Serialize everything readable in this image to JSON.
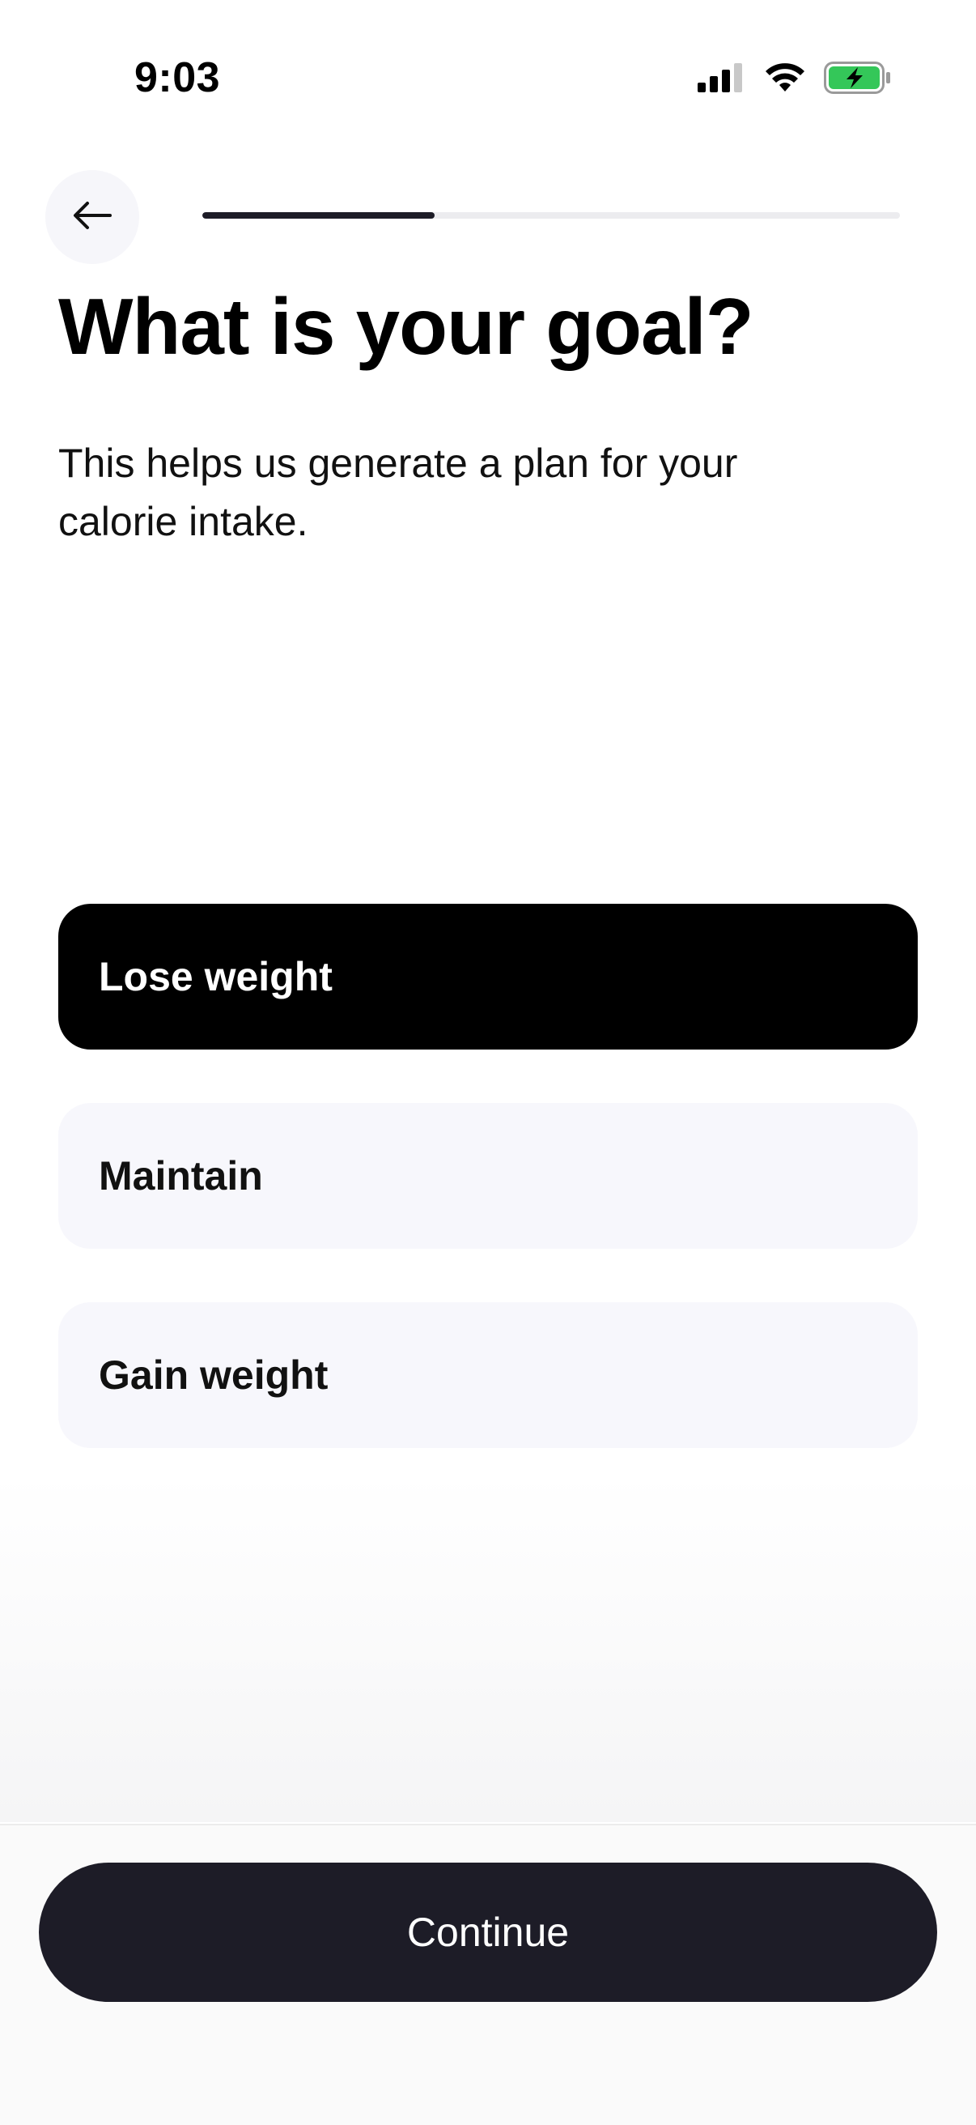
{
  "status_bar": {
    "time": "9:03",
    "icons": [
      "cellular-signal-icon",
      "wifi-icon",
      "battery-charging-icon"
    ],
    "battery_color": "#34c759"
  },
  "nav": {
    "back_icon": "arrow-left-icon",
    "progress": 0.333
  },
  "header": {
    "title": "What is your goal?",
    "subtitle": "This helps us generate a plan for your calorie intake."
  },
  "options": [
    {
      "label": "Lose weight",
      "selected": true
    },
    {
      "label": "Maintain",
      "selected": false
    },
    {
      "label": "Gain weight",
      "selected": false
    }
  ],
  "footer": {
    "continue_label": "Continue"
  },
  "colors": {
    "accent_dark": "#1d1c27",
    "selected_option_bg": "#000000",
    "option_bg": "#f7f7fc",
    "progress_track": "#ececef"
  }
}
